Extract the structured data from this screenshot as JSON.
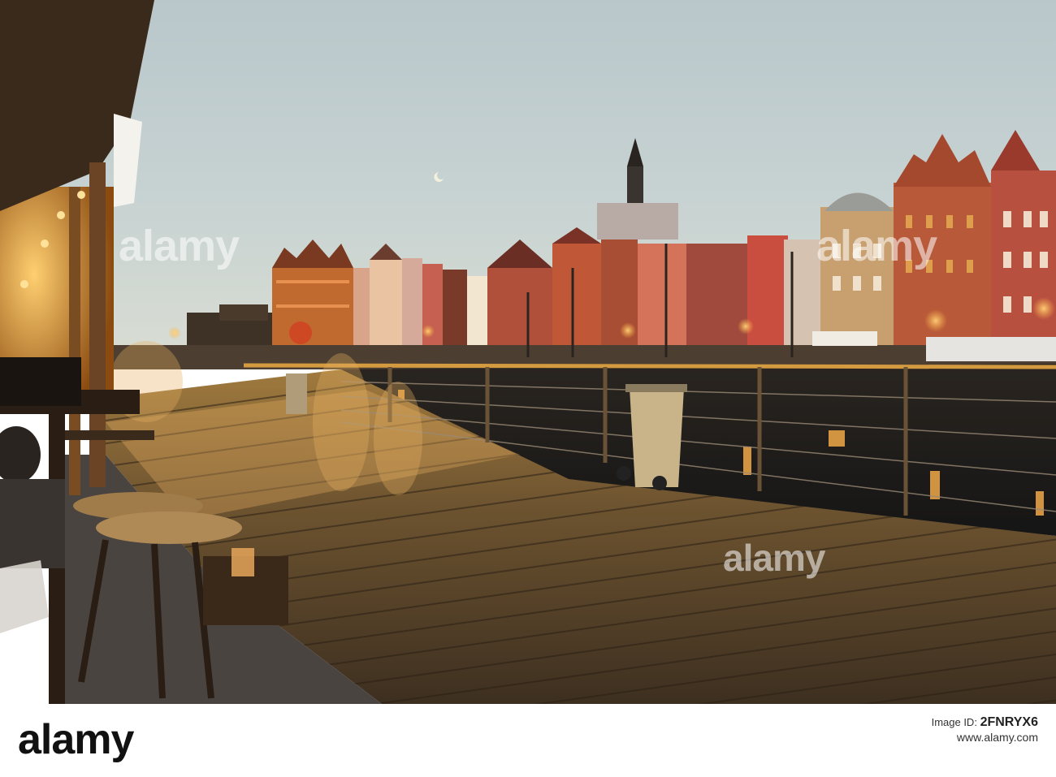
{
  "watermark": {
    "text": "alamy"
  },
  "footer": {
    "logo": "alamy",
    "image_id_prefix": "Image ID:",
    "image_id": "2FNRYX6",
    "site": "www.alamy.com"
  }
}
